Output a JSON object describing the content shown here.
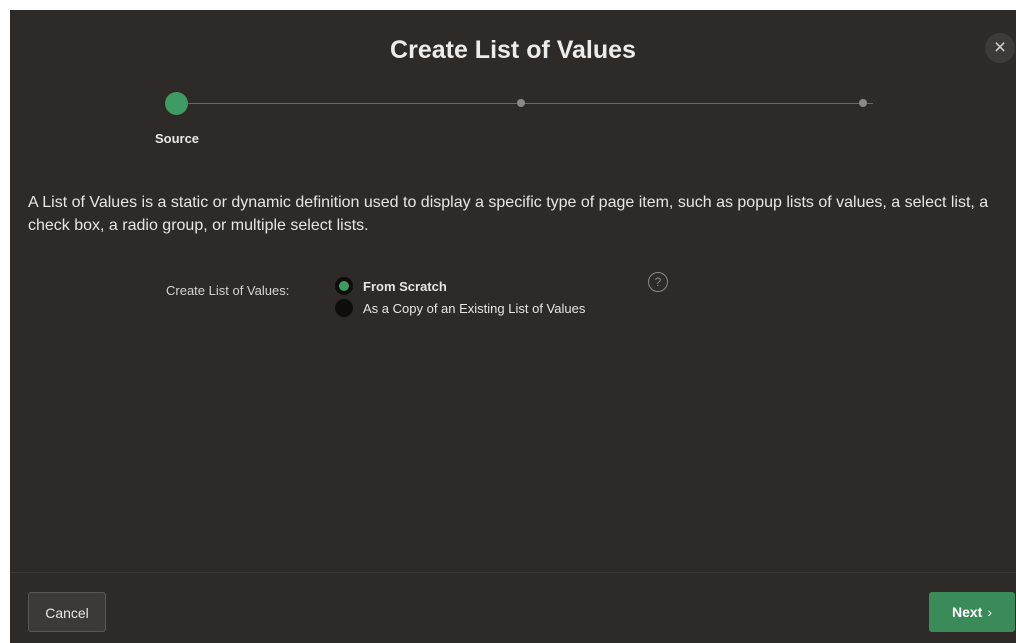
{
  "dialog": {
    "title": "Create List of Values",
    "close_icon": "close-icon",
    "close_glyph": "×"
  },
  "wizard": {
    "steps": [
      {
        "label": "Source",
        "state": "active"
      },
      {
        "label": "",
        "state": "pending"
      },
      {
        "label": "",
        "state": "pending"
      }
    ]
  },
  "main": {
    "description": "A List of Values is a static or dynamic definition used to display a specific type of page item, such as popup lists of values, a select list, a check box, a radio group, or multiple select lists.",
    "field_label": "Create List of Values:",
    "options": [
      {
        "label": "From Scratch",
        "selected": true
      },
      {
        "label": "As a Copy of an Existing List of Values",
        "selected": false
      }
    ],
    "help_icon": "help-icon",
    "help_glyph": "?"
  },
  "footer": {
    "cancel_label": "Cancel",
    "next_label": "Next",
    "next_icon": "chevron-right-icon",
    "next_glyph": "›"
  },
  "colors": {
    "background": "#2d2a27",
    "accent": "#3f9b64",
    "next_button": "#3b8a59"
  }
}
